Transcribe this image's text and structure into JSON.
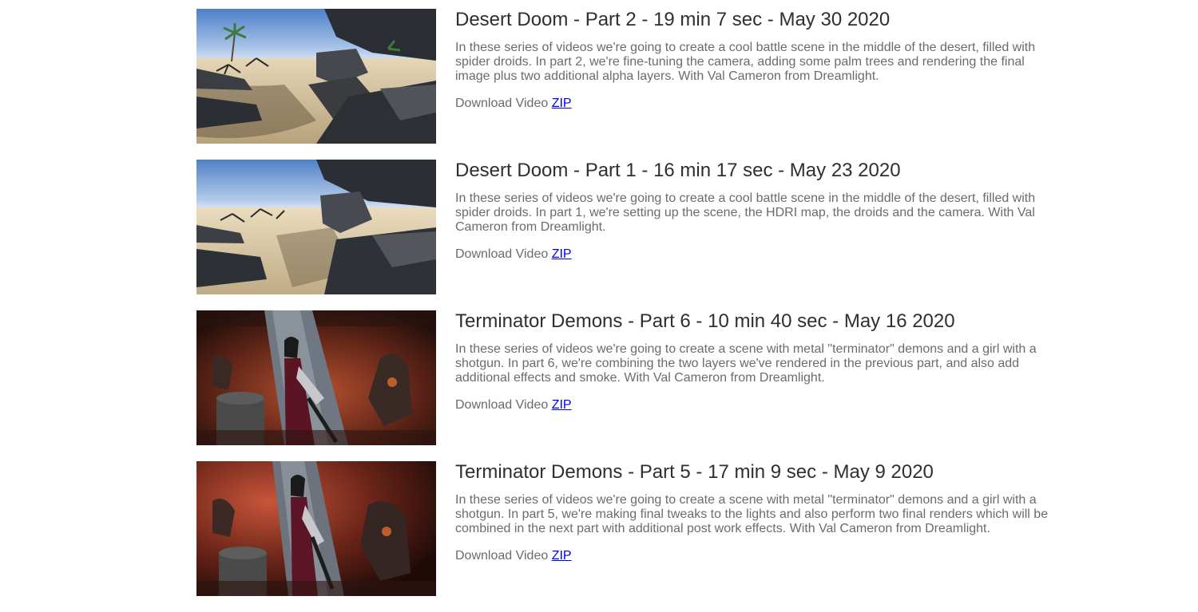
{
  "videos": [
    {
      "title": "Desert Doom - Part 2 - 19 min 7 sec - May 30 2020",
      "description": "In these series of videos we're going to create a cool battle scene in the middle of the desert, filled with spider droids. In part 2, we're fine-tuning the camera, adding some palm trees and rendering the final image plus two additional alpha layers. With Val Cameron from Dreamlight.",
      "download_label": "Download Video",
      "link_label": "ZIP",
      "thumbnail": "desert-battle-droids-palm-trees"
    },
    {
      "title": "Desert Doom - Part 1 - 16 min 17 sec - May 23 2020",
      "description": "In these series of videos we're going to create a cool battle scene in the middle of the desert, filled with spider droids. In part 1, we're setting up the scene, the HDRI map, the droids and the camera. With Val Cameron from Dreamlight.",
      "download_label": "Download Video",
      "link_label": "ZIP",
      "thumbnail": "desert-battle-droids"
    },
    {
      "title": "Terminator Demons - Part 6 - 10 min 40 sec - May 16 2020",
      "description": "In these series of videos we're going to create a scene with metal \"terminator\" demons and a girl with a shotgun. In part 6, we're combining the two layers we've rendered in the previous part, and also add additional effects and smoke. With Val Cameron from Dreamlight.",
      "download_label": "Download Video",
      "link_label": "ZIP",
      "thumbnail": "girl-shotgun-terminator-demons"
    },
    {
      "title": "Terminator Demons - Part 5 - 17 min 9 sec - May 9 2020",
      "description": "In these series of videos we're going to create a scene with metal \"terminator\" demons and a girl with a shotgun. In part 5, we're making final tweaks to the lights and also perform two final renders which will be combined in the next part with additional post work effects. With Val Cameron from Dreamlight.",
      "download_label": "Download Video",
      "link_label": "ZIP",
      "thumbnail": "girl-shotgun-terminator-demons"
    }
  ]
}
